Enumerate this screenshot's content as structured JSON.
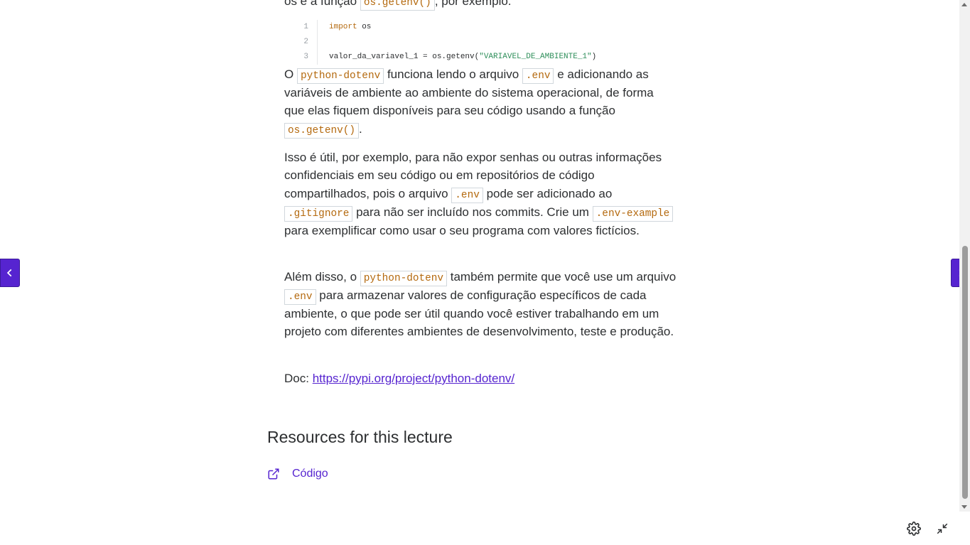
{
  "article": {
    "cut_line_prefix": "os e a função ",
    "cut_line_code": "os.getenv()",
    "cut_line_suffix": ", por exemplo.",
    "code_block": {
      "lines": [
        {
          "num": "1",
          "kw": "import",
          "rest": " os"
        },
        {
          "num": "2",
          "text": ""
        },
        {
          "num": "3",
          "pre": "valor_da_variavel_1 = os.getenv(",
          "str": "\"VARIAVEL_DE_AMBIENTE_1\"",
          "post": ")"
        }
      ]
    },
    "p1": {
      "t1": "O ",
      "c1": "python-dotenv",
      "t2": " funciona lendo o arquivo ",
      "c2": ".env",
      "t3": " e adicionando as variáveis de ambiente ao ambiente do sistema operacional, de forma que elas fiquem disponíveis para seu código usando a função ",
      "c3": "os.getenv()",
      "t4": "."
    },
    "p2": {
      "t1": "Isso é útil, por exemplo, para não expor senhas ou outras informações confidenciais em seu código ou em repositórios de código compartilhados, pois o arquivo ",
      "c1": ".env",
      "t2": " pode ser adicionado ao ",
      "c2": ".gitignore",
      "t3": " para não ser incluído nos commits. Crie um ",
      "c3": ".env-example",
      "t4": " para exemplificar como usar o seu programa com valores fictícios."
    },
    "p3": {
      "t1": "Além disso, o ",
      "c1": "python-dotenv",
      "t2": " também permite que você use um arquivo ",
      "c2": ".env",
      "t3": " para armazenar valores de configuração específicos de cada ambiente, o que pode ser útil quando você estiver trabalhando em um projeto com diferentes ambientes de desenvolvimento, teste e produção."
    },
    "doc": {
      "label": "Doc: ",
      "link": "https://pypi.org/project/python-dotenv/"
    }
  },
  "resources": {
    "title": "Resources for this lecture",
    "items": [
      {
        "label": "Código",
        "icon": "external-link-icon"
      }
    ]
  },
  "colors": {
    "accent": "#5624d0",
    "code_text": "#b4690e",
    "string": "#2f8f5b",
    "body_text": "#2d2f31"
  }
}
